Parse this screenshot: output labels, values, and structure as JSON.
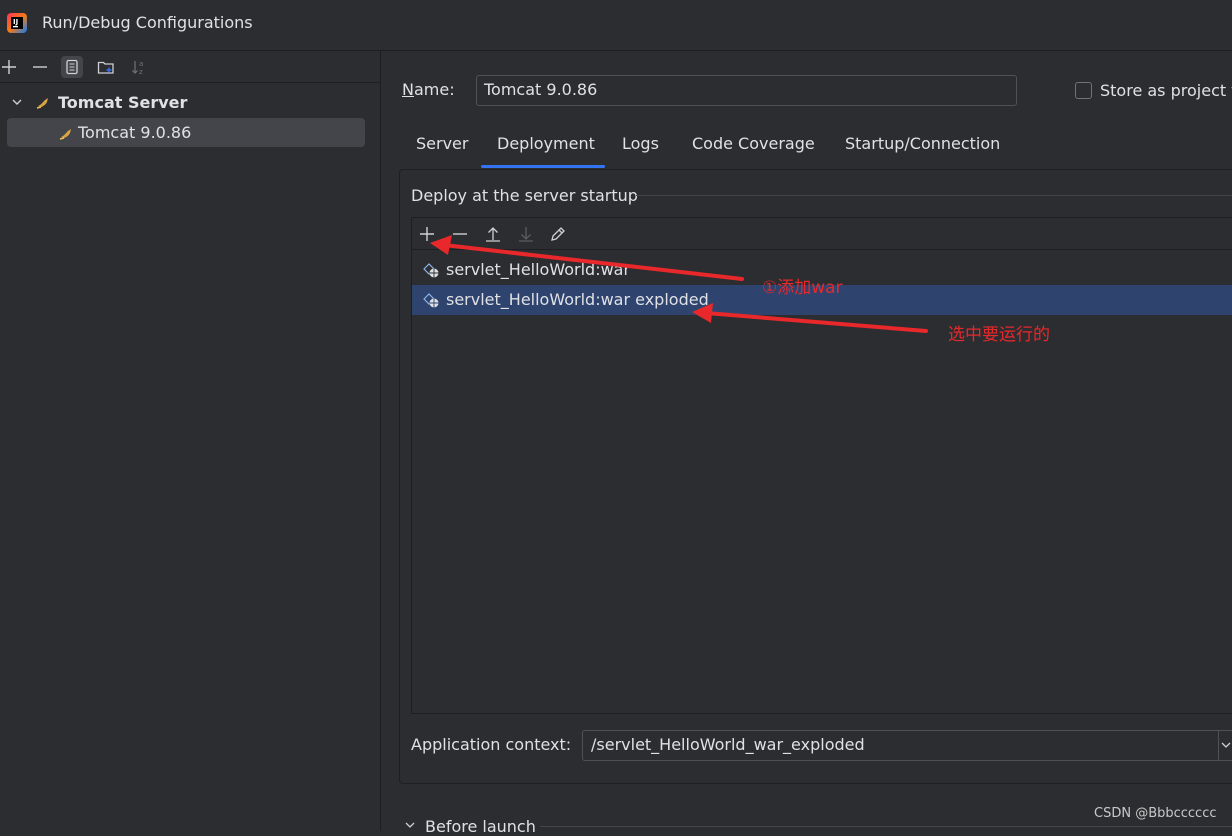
{
  "window": {
    "title": "Run/Debug Configurations",
    "app_icon": "intellij-idea-icon"
  },
  "left_toolbar": {
    "icons": [
      "add-icon",
      "remove-icon",
      "copy-icon",
      "new-folder-icon",
      "sort-icon"
    ]
  },
  "tree": {
    "group": {
      "label": "Tomcat Server",
      "icon": "tomcat-icon",
      "expanded": true
    },
    "item": {
      "label": "Tomcat 9.0.86",
      "icon": "tomcat-icon",
      "selected": true
    }
  },
  "name_field": {
    "label_underlined": "N",
    "label_rest": "ame:",
    "value": "Tomcat 9.0.86"
  },
  "store_option": {
    "label": "Store as project f",
    "checked": false
  },
  "tabs": [
    {
      "label": "Server"
    },
    {
      "label": "Deployment",
      "active": true
    },
    {
      "label": "Logs"
    },
    {
      "label": "Code Coverage"
    },
    {
      "label": "Startup/Connection"
    }
  ],
  "deploy": {
    "group_title": "Deploy at the server startup",
    "toolbar_icons": [
      "add-icon",
      "remove-icon",
      "move-up-icon",
      "move-down-icon",
      "edit-icon"
    ],
    "items": [
      {
        "label": "servlet_HelloWorld:war",
        "icon": "artifact-icon",
        "selected": false
      },
      {
        "label": "servlet_HelloWorld:war exploded",
        "icon": "artifact-icon",
        "selected": true
      }
    ]
  },
  "app_context": {
    "label": "Application context:",
    "value": "/servlet_HelloWorld_war_exploded"
  },
  "before_launch": {
    "label": "Before launch"
  },
  "annotations": [
    {
      "text": "①添加war",
      "color": "#e8282b"
    },
    {
      "text": "选中要运行的",
      "color": "#e8282b"
    }
  ],
  "watermark": "CSDN @Bbbcccccc",
  "colors": {
    "accent": "#3574f0",
    "selection": "#2e436e",
    "background": "#2b2d30",
    "annotation": "#e8282b"
  }
}
